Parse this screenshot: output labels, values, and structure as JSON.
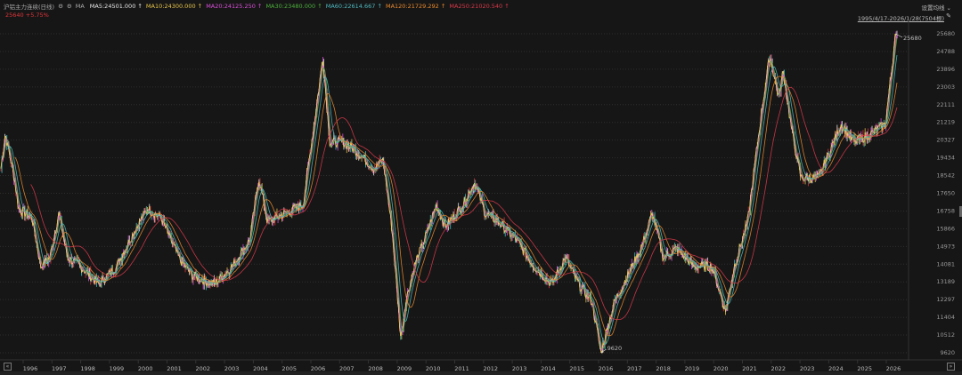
{
  "header": {
    "title": "沪铝主力连续(日线)",
    "icons": [
      "gear-icon",
      "settings-icon"
    ],
    "ma_label": "MA",
    "ma": [
      {
        "label": "MA5:24501.000",
        "color": "#e8e8e8"
      },
      {
        "label": "MA10:24300.000",
        "color": "#e6c34a"
      },
      {
        "label": "MA20:24125.250",
        "color": "#d94fd9"
      },
      {
        "label": "MA30:23480.000",
        "color": "#4caf3c"
      },
      {
        "label": "MA60:22614.667",
        "color": "#4fb8c0"
      },
      {
        "label": "MA120:21729.292",
        "color": "#e8892e"
      },
      {
        "label": "MA250:21020.540",
        "color": "#d8384a"
      }
    ],
    "price_change": "25640 +5.75%"
  },
  "settings_label": "设置均线 ⌄",
  "date_range": "1995/4/17-2026/1/28(7504根)",
  "annotations": {
    "high": "25680",
    "low": "9620"
  },
  "colors": {
    "background": "#161616",
    "up": "#e0353b",
    "down": "#3fc7c7"
  },
  "chart_data": {
    "type": "candlestick",
    "ylim": [
      9620,
      25680
    ],
    "yticks": [
      "25680",
      "24788",
      "23896",
      "23003",
      "22111",
      "21219",
      "20327",
      "19434",
      "18542",
      "17650",
      "16758",
      "15866",
      "14973",
      "14081",
      "13189",
      "12297",
      "11404",
      "10512",
      "9620"
    ],
    "xticks": [
      "1996",
      "1997",
      "1998",
      "1999",
      "2000",
      "2001",
      "2002",
      "2003",
      "2004",
      "2005",
      "2006",
      "2007",
      "2008",
      "2009",
      "2010",
      "2011",
      "2012",
      "2013",
      "2014",
      "2015",
      "2016",
      "2017",
      "2018",
      "2019",
      "2020",
      "2021",
      "2022",
      "2023",
      "2024",
      "2025",
      "2026"
    ],
    "xlim": [
      1995.3,
      2026.08
    ],
    "series": [
      [
        1995.3,
        18900
      ],
      [
        1995.45,
        20670
      ],
      [
        1995.76,
        18430
      ],
      [
        1995.91,
        16870
      ],
      [
        1996.37,
        16420
      ],
      [
        1996.67,
        13960
      ],
      [
        1996.98,
        14410
      ],
      [
        1997.29,
        16640
      ],
      [
        1997.59,
        14410
      ],
      [
        1998.05,
        13960
      ],
      [
        1998.66,
        13070
      ],
      [
        1999.27,
        13960
      ],
      [
        1999.88,
        15750
      ],
      [
        2000.34,
        16870
      ],
      [
        2000.8,
        16420
      ],
      [
        2001.41,
        14410
      ],
      [
        2001.87,
        13510
      ],
      [
        2002.63,
        13070
      ],
      [
        2003.24,
        13960
      ],
      [
        2003.85,
        15300
      ],
      [
        2004.16,
        18430
      ],
      [
        2004.46,
        16200
      ],
      [
        2005.07,
        16640
      ],
      [
        2005.68,
        17090
      ],
      [
        2006.14,
        22010
      ],
      [
        2006.36,
        24500
      ],
      [
        2006.6,
        20220
      ],
      [
        2007.06,
        20220
      ],
      [
        2007.52,
        19780
      ],
      [
        2008.13,
        18880
      ],
      [
        2008.43,
        19330
      ],
      [
        2008.74,
        15750
      ],
      [
        2009.04,
        10300
      ],
      [
        2009.2,
        12170
      ],
      [
        2009.5,
        13960
      ],
      [
        2009.96,
        15750
      ],
      [
        2010.26,
        17090
      ],
      [
        2010.57,
        15970
      ],
      [
        2011.18,
        17090
      ],
      [
        2011.58,
        18210
      ],
      [
        2011.94,
        16640
      ],
      [
        2012.4,
        16200
      ],
      [
        2013.01,
        15300
      ],
      [
        2013.62,
        13960
      ],
      [
        2014.23,
        13070
      ],
      [
        2014.69,
        14410
      ],
      [
        2015.15,
        13070
      ],
      [
        2015.61,
        12170
      ],
      [
        2015.91,
        9620
      ],
      [
        2016.37,
        12170
      ],
      [
        2016.68,
        13070
      ],
      [
        2017.29,
        14860
      ],
      [
        2017.68,
        16640
      ],
      [
        2018.05,
        14410
      ],
      [
        2018.51,
        14860
      ],
      [
        2019.12,
        13960
      ],
      [
        2019.73,
        13960
      ],
      [
        2020.19,
        11720
      ],
      [
        2020.49,
        13960
      ],
      [
        2020.95,
        16200
      ],
      [
        2021.41,
        21560
      ],
      [
        2021.71,
        24600
      ],
      [
        2022.02,
        22460
      ],
      [
        2022.17,
        23800
      ],
      [
        2022.48,
        20670
      ],
      [
        2022.78,
        18430
      ],
      [
        2023.39,
        18430
      ],
      [
        2024.16,
        21120
      ],
      [
        2024.61,
        20220
      ],
      [
        2025.22,
        20670
      ],
      [
        2025.68,
        21120
      ],
      [
        2025.93,
        24250
      ],
      [
        2026.02,
        25680
      ],
      [
        2026.08,
        25640
      ]
    ]
  }
}
